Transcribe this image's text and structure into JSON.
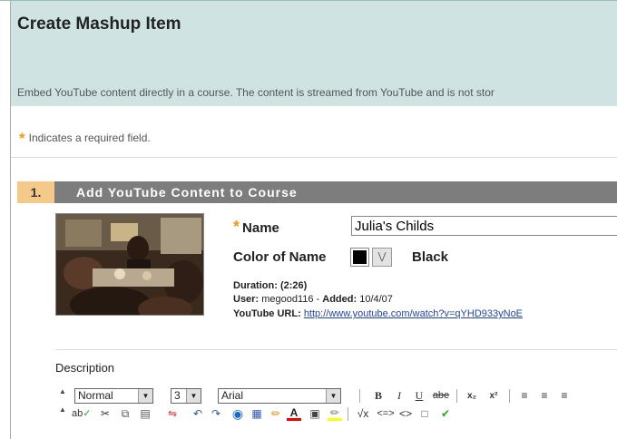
{
  "header": {
    "title": "Create Mashup Item",
    "description": "Embed YouTube content directly in a course. The content is streamed from YouTube and is not stor"
  },
  "required_note": {
    "star": "*",
    "text": "Indicates a required field."
  },
  "step": {
    "number": "1.",
    "title": "Add YouTube Content to Course"
  },
  "thumbnail": {
    "alt": "video-thumbnail"
  },
  "form": {
    "name_star": "*",
    "name_label": "Name",
    "name_value": "Julia's Childs",
    "color_label": "Color of Name",
    "color_value": "Black",
    "color_swatch": "#000000"
  },
  "meta": {
    "duration_label": "Duration:",
    "duration_value": "(2:26)",
    "user_label": "User:",
    "user_value": "megood116 -",
    "added_label": "Added:",
    "added_value": "10/4/07",
    "url_label": "YouTube URL:",
    "url_value": "http://www.youtube.com/watch?v=qYHD933yNoE"
  },
  "description_label": "Description",
  "toolbar": {
    "format_value": "Normal",
    "size_value": "3",
    "font_value": "Arial",
    "row1_icons": [
      "bold-icon",
      "italic-icon",
      "underline-icon",
      "strikethrough-icon",
      "subscript-icon",
      "superscript-icon",
      "align-left-icon",
      "align-center-icon"
    ],
    "row2_icons": [
      "spellcheck-icon",
      "cut-icon",
      "copy-icon",
      "paste-icon",
      "unlink-icon",
      "undo-icon",
      "redo-icon",
      "web-icon",
      "table-icon",
      "pencil-icon",
      "font-color-icon",
      "emoticon-icon",
      "highlight-icon",
      "equation-icon",
      "source-icon",
      "html-icon",
      "preview-icon",
      "check-icon"
    ],
    "bold": "B",
    "italic": "I",
    "underline": "U",
    "strike": "abe",
    "sub": "x₂",
    "sup": "x²"
  },
  "colors": {
    "header_bg": "#cfe3e3",
    "step_bar": "#7d7d7d",
    "step_num_bg": "#f4c98a",
    "accent": "#f39b13",
    "link": "#2244aa"
  }
}
